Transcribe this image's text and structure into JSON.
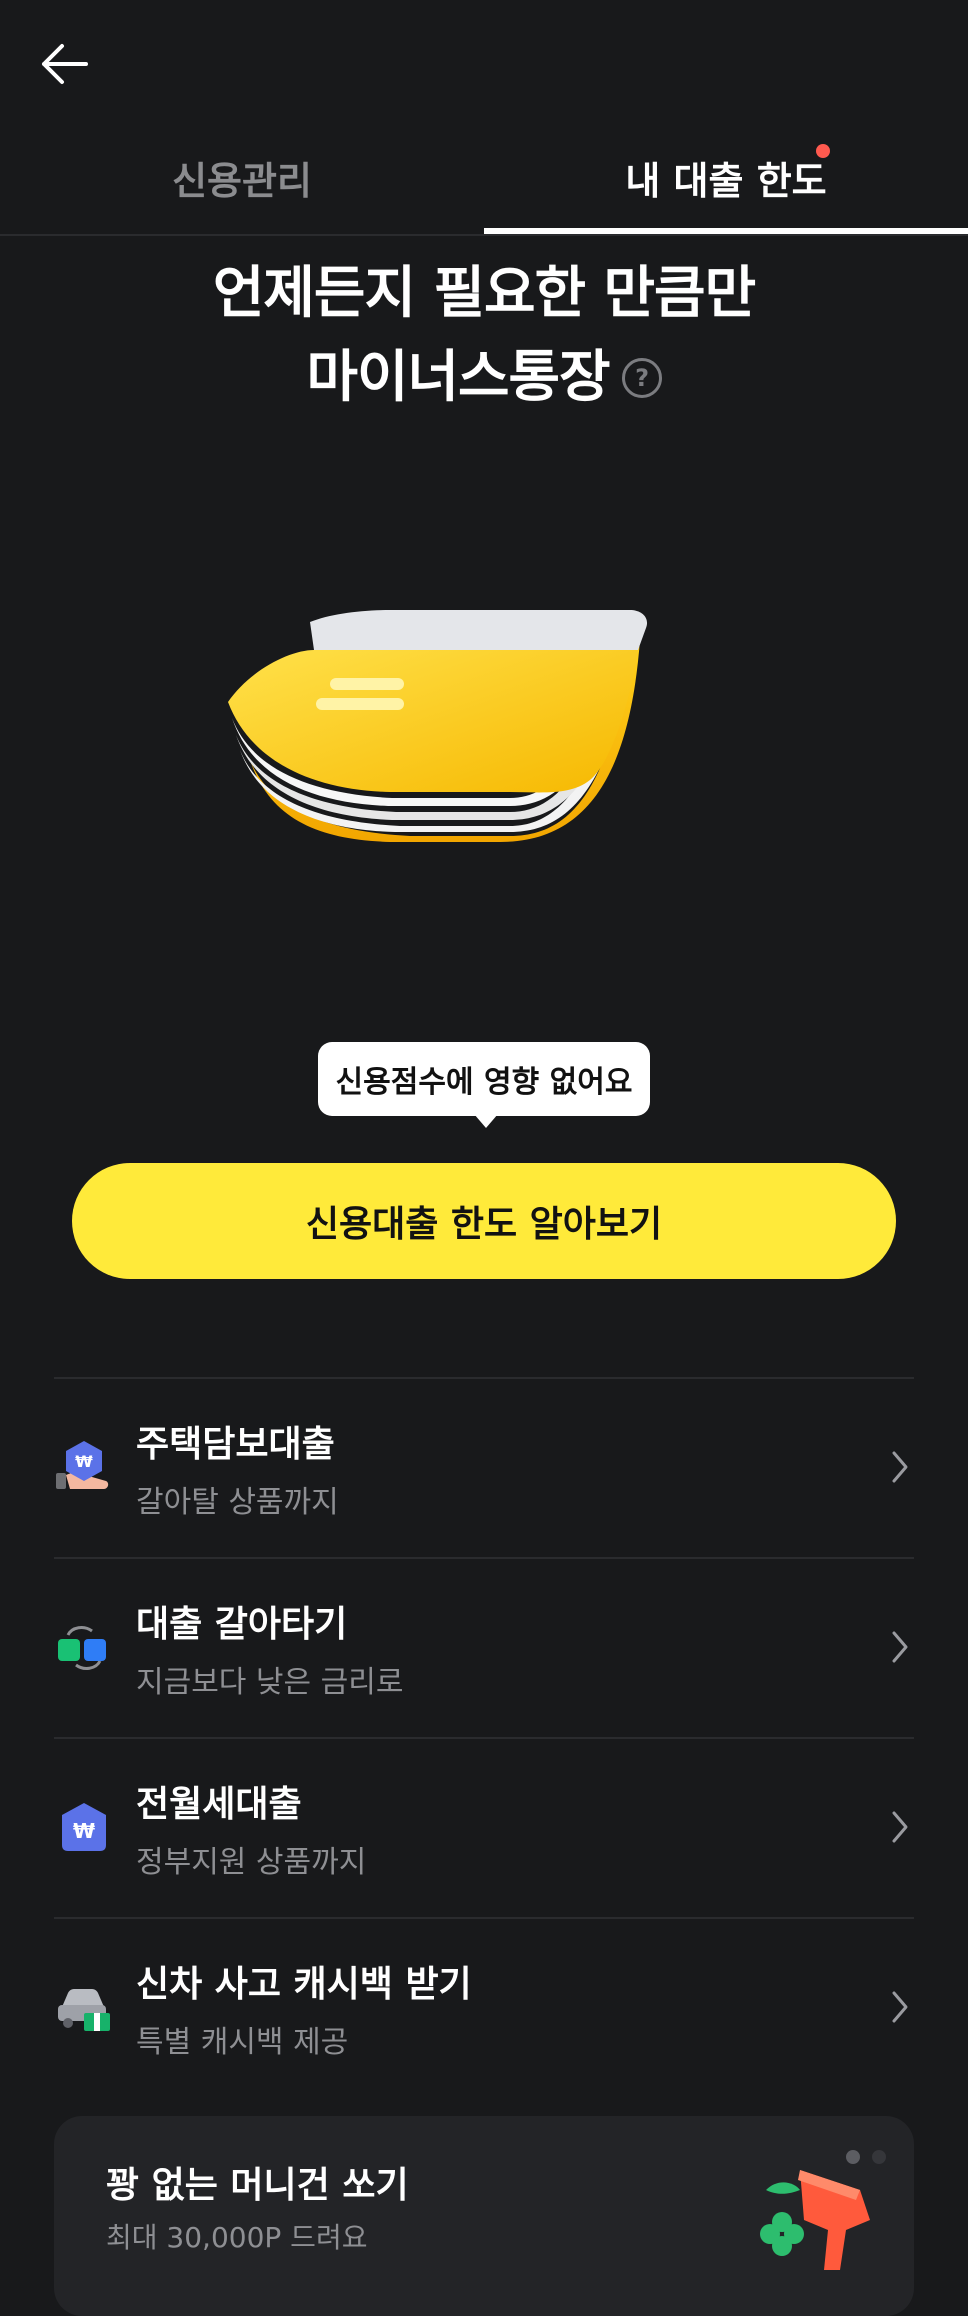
{
  "tabs": [
    {
      "label": "신용관리",
      "active": false
    },
    {
      "label": "내 대출 한도",
      "active": true
    }
  ],
  "hero": {
    "title_line1": "언제든지 필요한 만큼만",
    "title_line2": "마이너스통장",
    "help_glyph": "?"
  },
  "tooltip": {
    "text": "신용점수에 영향 없어요"
  },
  "cta": {
    "label": "신용대출 한도 알아보기"
  },
  "menu": [
    {
      "title": "주택담보대출",
      "subtitle": "갈아탈 상품까지",
      "icon": "house-loan-icon"
    },
    {
      "title": "대출 갈아타기",
      "subtitle": "지금보다 낮은 금리로",
      "icon": "swap-loan-icon"
    },
    {
      "title": "전월세대출",
      "subtitle": "정부지원 상품까지",
      "icon": "rent-loan-icon"
    },
    {
      "title": "신차 사고 캐시백 받기",
      "subtitle": "특별 캐시백 제공",
      "icon": "car-cashback-icon"
    }
  ],
  "promo": {
    "title": "꽝 없는 머니건 쏘기",
    "subtitle": "최대 30,000P 드려요",
    "page_total": 2,
    "page_active": 1
  },
  "colors": {
    "background": "#18191b",
    "accent_yellow": "#ffea3a",
    "notification_dot": "#ff5a4f",
    "muted_text": "#8e8f93"
  }
}
